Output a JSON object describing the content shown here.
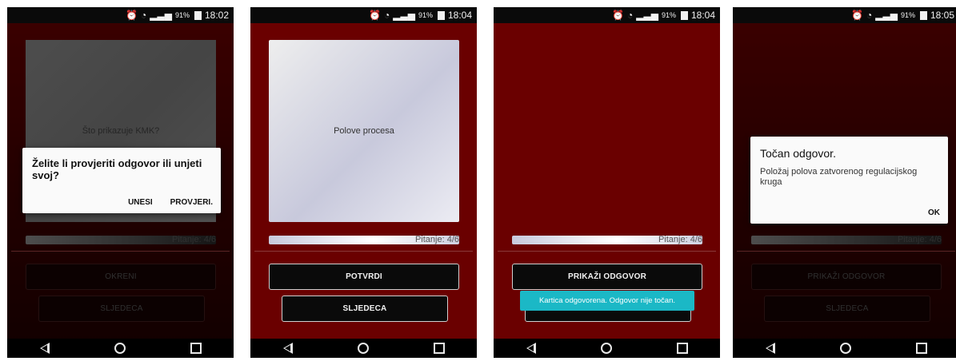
{
  "screens": [
    {
      "status": {
        "battery": "91%",
        "time": "18:02"
      },
      "card_text": "Što prikazuje KMK?",
      "progress_label": "Pitanje: 4/6",
      "progress_fraction": 0.67,
      "primary_button": "OKRENI",
      "secondary_button": "SLJEDECA",
      "dialog": {
        "title": "Želite li provjeriti odgovor ili unjeti svoj?",
        "btn_left": "UNESI",
        "btn_right": "PROVJERI."
      }
    },
    {
      "status": {
        "battery": "91%",
        "time": "18:04"
      },
      "card_text": "Polove procesa",
      "progress_label": "Pitanje: 4/6",
      "progress_fraction": 0.67,
      "primary_button": "POTVRDI",
      "secondary_button": "SLJEDECA"
    },
    {
      "status": {
        "battery": "91%",
        "time": "18:04"
      },
      "progress_label": "Pitanje: 4/6",
      "progress_fraction": 0.67,
      "primary_button": "PRIKAŽI ODGOVOR",
      "secondary_button": "SLJEDECA",
      "toast": "Kartica odgovorena. Odgovor nije točan."
    },
    {
      "status": {
        "battery": "91%",
        "time": "18:05"
      },
      "progress_label": "Pitanje: 4/6",
      "progress_fraction": 0.67,
      "primary_button": "PRIKAŽI ODGOVOR",
      "secondary_button": "SLJEDECA",
      "dialog": {
        "title": "Točan odgovor.",
        "message": "Položaj polova zatvorenog regulacijskog kruga",
        "btn_ok": "OK"
      }
    }
  ],
  "icons": {
    "status": [
      "alarm-icon",
      "wifi-icon",
      "signal-icon",
      "battery-icon"
    ],
    "nav": [
      "back-icon",
      "home-icon",
      "recent-apps-icon"
    ]
  },
  "colors": {
    "background": "#6a0000",
    "toast": "#1bb8c6",
    "dialog": "#fafafa"
  }
}
